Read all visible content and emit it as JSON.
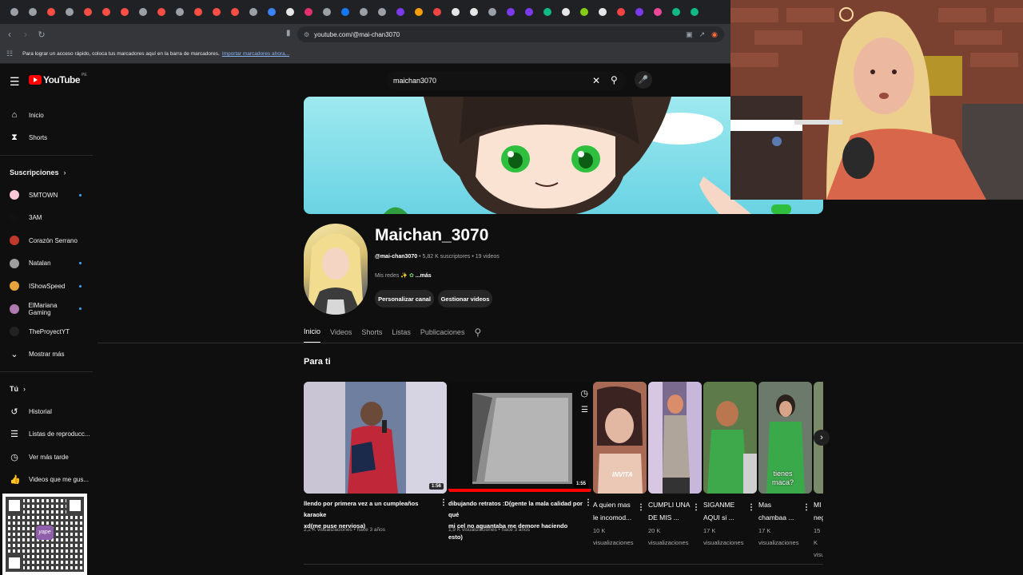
{
  "browser": {
    "url": "youtube.com/@mai-chan3070",
    "bookmarks_message": "Para lograr un acceso rápido, coloca tus marcadores aquí en la barra de marcadores.",
    "bookmarks_link": "Importar marcadores ahora...",
    "tab_favicon_colors": [
      "#9aa0a6",
      "#9aa0a6",
      "#ff4e45",
      "#9aa0a6",
      "#ff4e45",
      "#ff4e45",
      "#ff4e45",
      "#9aa0a6",
      "#ff4e45",
      "#9aa0a6",
      "#ff4e45",
      "#ff4e45",
      "#ff4e45",
      "#9aa0a6",
      "#3b82f6",
      "#e6e6e6",
      "#e1306c",
      "#9aa0a6",
      "#1877f2",
      "#9aa0a6",
      "#9aa0a6",
      "#7c3aed",
      "#f59e0b",
      "#ef4444",
      "#e6e6e6",
      "#e6e6e6",
      "#9aa0a6",
      "#7c3aed",
      "#7c3aed",
      "#10b981",
      "#e6e6e6",
      "#84cc16",
      "#e6e6e6",
      "#ef4444",
      "#7c3aed",
      "#ec4899",
      "#10b981",
      "#10b981"
    ]
  },
  "header": {
    "logo_text": "YouTube",
    "country_code": "PE",
    "search_value": "maichan3070"
  },
  "sidebar": {
    "main": [
      {
        "label": "Inicio",
        "icon": "home-icon"
      },
      {
        "label": "Shorts",
        "icon": "shorts-icon"
      }
    ],
    "subscriptions_title": "Suscripciones",
    "subscriptions": [
      {
        "label": "SMTOWN",
        "color": "#f8c8d8",
        "new": true
      },
      {
        "label": "3AM",
        "color": "#111111",
        "new": false
      },
      {
        "label": "Corazón Serrano",
        "color": "#c0392b",
        "new": false
      },
      {
        "label": "Natalan",
        "color": "#9e9e9e",
        "new": true
      },
      {
        "label": "IShowSpeed",
        "color": "#e6a23c",
        "new": true
      },
      {
        "label": "ElMariana Gaming",
        "color": "#b07ab0",
        "new": true
      },
      {
        "label": "TheProyectYT",
        "color": "#222222",
        "new": false
      }
    ],
    "show_more": "Mostrar más",
    "you_title": "Tú",
    "you_items": [
      {
        "label": "Historial",
        "icon": "history-icon"
      },
      {
        "label": "Listas de reproducc...",
        "icon": "playlists-icon"
      },
      {
        "label": "Ver más tarde",
        "icon": "watch-later-icon"
      },
      {
        "label": "Videos que me gus...",
        "icon": "like-icon"
      }
    ],
    "qr_logo": "yape"
  },
  "channel": {
    "name": "Maichan_3070",
    "handle": "@mai-chan3070",
    "subscribers": "5,82 K suscriptores",
    "video_count": "19 videos",
    "links_prefix": "Mis redes",
    "links_more": "...más",
    "customize_button": "Personalizar canal",
    "manage_button": "Gestionar videos"
  },
  "tabs": [
    "Inicio",
    "Videos",
    "Shorts",
    "Listas",
    "Publicaciones"
  ],
  "active_tab": "Inicio",
  "section_title": "Para ti",
  "videos": [
    {
      "title_line1": "llendo por primera vez a un cumpleaños karaoke",
      "title_line2": "xd(me puse nerviosa)",
      "duration": "1:56",
      "meta": "2,2 K visualizaciones • hace 3 años"
    },
    {
      "title_line1": "dibujando retratos :D(gente la mala calidad por qué",
      "title_line2": "mi cel no aguantaba me demore haciendo esto)",
      "duration": "1:55",
      "meta": "1,9 K visualizaciones • hace 3 años"
    }
  ],
  "shorts": [
    {
      "line1": "A quien mas",
      "line2": "le incomod...",
      "views": "10 K",
      "views_label": "visualizaciones",
      "overlay": "INVITA"
    },
    {
      "line1": "CUMPLI UNA",
      "line2": "DE MIS ...",
      "views": "20 K",
      "views_label": "visualizaciones",
      "overlay": ""
    },
    {
      "line1": "SIGANME",
      "line2": "AQUI si ...",
      "views": "17 K",
      "views_label": "visualizaciones",
      "overlay": ""
    },
    {
      "line1": "Mas",
      "line2": "chambaa ...",
      "views": "17 K",
      "views_label": "visualizaciones",
      "overlay": "tienes\nmaca?"
    },
    {
      "line1": "MI I",
      "line2": "neg",
      "views": "15 K",
      "views_label": "visu",
      "overlay": ""
    }
  ]
}
